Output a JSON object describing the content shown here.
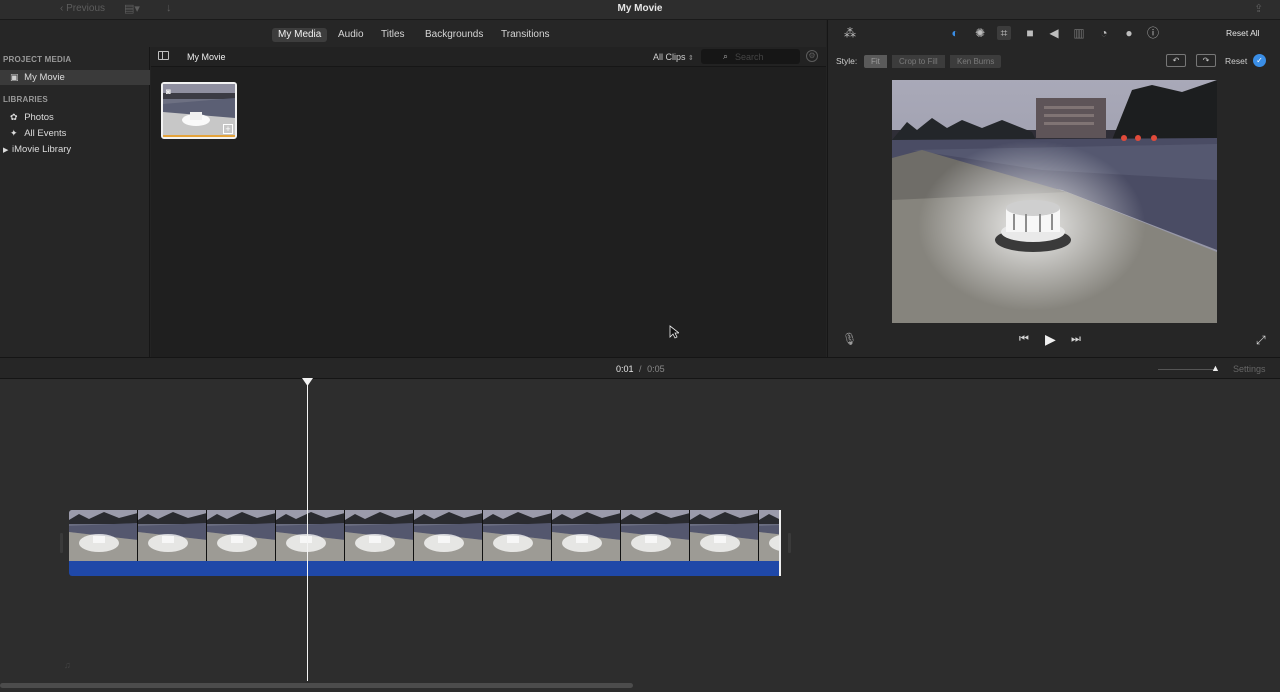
{
  "window": {
    "title": "My Movie",
    "back_label": "Previous"
  },
  "media_tabs": [
    "My Media",
    "Audio",
    "Titles",
    "Backgrounds",
    "Transitions"
  ],
  "sidebar": {
    "project_header": "PROJECT MEDIA",
    "project_item": "My Movie",
    "libraries_header": "LIBRARIES",
    "items": [
      "Photos",
      "All Events",
      "iMovie Library"
    ]
  },
  "browser": {
    "title": "My Movie",
    "filter": "All Clips",
    "search_placeholder": "Search"
  },
  "viewer": {
    "reset_all": "Reset All",
    "style_label": "Style:",
    "style_options": [
      "Fit",
      "Crop to Fill",
      "Ken Burns"
    ],
    "reset": "Reset"
  },
  "timeline": {
    "current_time": "0:01",
    "separator": "/",
    "total_time": "0:05",
    "settings": "Settings"
  },
  "colors": {
    "accent_blue": "#1f48a8",
    "check_blue": "#3a8ee6"
  },
  "icons": [
    "wand-icon",
    "color-balance-icon",
    "color-correction-icon",
    "crop-icon",
    "stabilization-icon",
    "volume-icon",
    "equalizer-icon",
    "speed-icon",
    "filter-icon",
    "info-icon",
    "microphone-icon",
    "skip-back-icon",
    "play-icon",
    "skip-forward-icon",
    "fullscreen-icon",
    "share-icon"
  ]
}
